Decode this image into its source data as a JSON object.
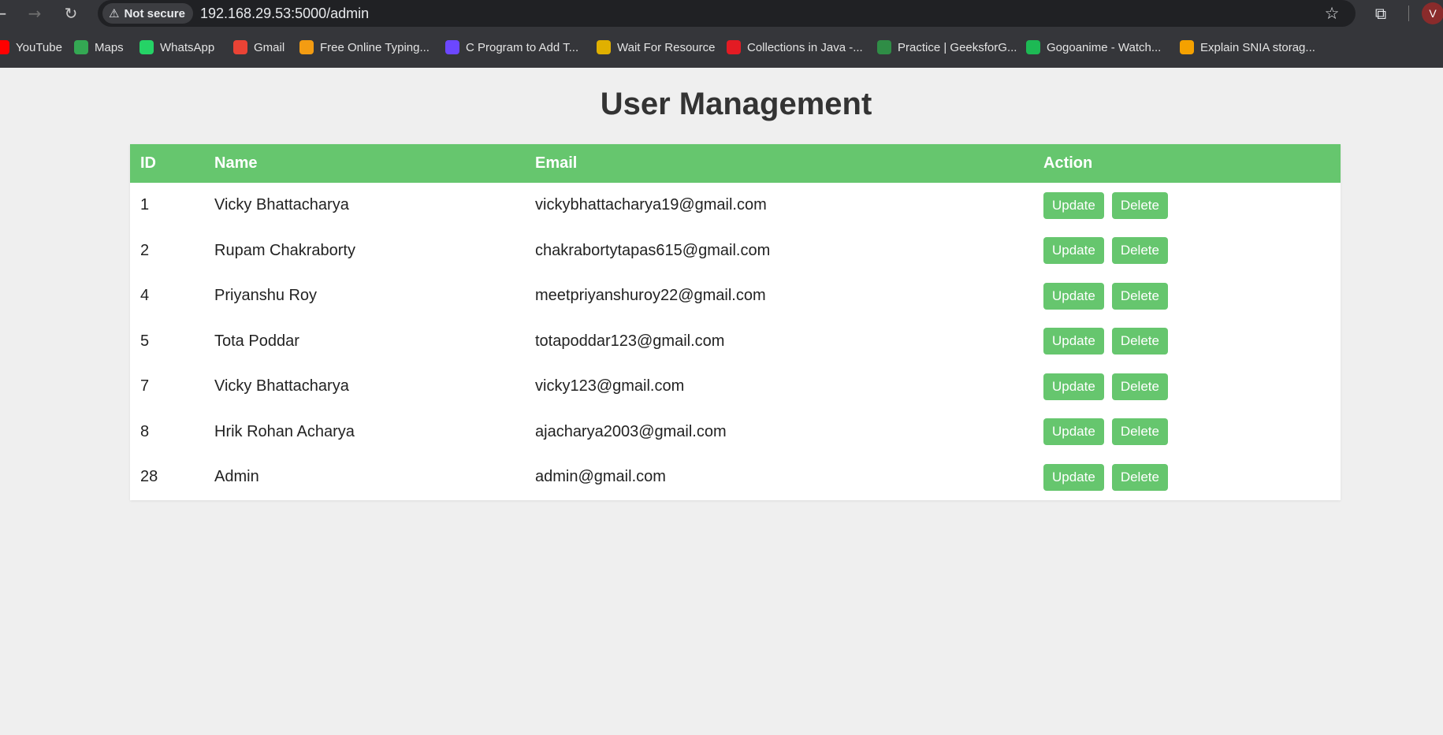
{
  "browser": {
    "security_label": "Not secure",
    "url": "192.168.29.53:5000/admin",
    "avatar_letter": "V",
    "bookmarks": [
      {
        "label": "YouTube",
        "icon": "youtube-icon",
        "color": "#ff0000"
      },
      {
        "label": "Maps",
        "icon": "maps-icon",
        "color": "#34a853"
      },
      {
        "label": "WhatsApp",
        "icon": "whatsapp-icon",
        "color": "#25d366"
      },
      {
        "label": "Gmail",
        "icon": "gmail-icon",
        "color": "#ea4335"
      },
      {
        "label": "Free Online Typing...",
        "icon": "typing-icon",
        "color": "#f39c12"
      },
      {
        "label": "C Program to Add T...",
        "icon": "programiz-icon",
        "color": "#6c47ff"
      },
      {
        "label": "Wait For Resource",
        "icon": "g-icon",
        "color": "#e0b000"
      },
      {
        "label": "Collections in Java -...",
        "icon": "javatpoint-icon",
        "color": "#e31b23"
      },
      {
        "label": "Practice | GeeksforG...",
        "icon": "geeksforgeeks-icon",
        "color": "#2f8d46"
      },
      {
        "label": "Gogoanime - Watch...",
        "icon": "gogoanime-icon",
        "color": "#1db954"
      },
      {
        "label": "Explain SNIA storag...",
        "icon": "search-result-icon",
        "color": "#f4a100"
      }
    ]
  },
  "page": {
    "title": "User Management",
    "accent_color": "#66c66e"
  },
  "table": {
    "headers": [
      "ID",
      "Name",
      "Email",
      "Action"
    ],
    "update_label": "Update",
    "delete_label": "Delete",
    "rows": [
      {
        "id": "1",
        "name": "Vicky Bhattacharya",
        "email": "vickybhattacharya19@gmail.com"
      },
      {
        "id": "2",
        "name": "Rupam Chakraborty",
        "email": "chakrabortytapas615@gmail.com"
      },
      {
        "id": "4",
        "name": "Priyanshu Roy",
        "email": "meetpriyanshuroy22@gmail.com"
      },
      {
        "id": "5",
        "name": "Tota Poddar",
        "email": "totapoddar123@gmail.com"
      },
      {
        "id": "7",
        "name": "Vicky Bhattacharya",
        "email": "vicky123@gmail.com"
      },
      {
        "id": "8",
        "name": "Hrik Rohan Acharya",
        "email": "ajacharya2003@gmail.com"
      },
      {
        "id": "28",
        "name": "Admin",
        "email": "admin@gmail.com"
      }
    ]
  }
}
